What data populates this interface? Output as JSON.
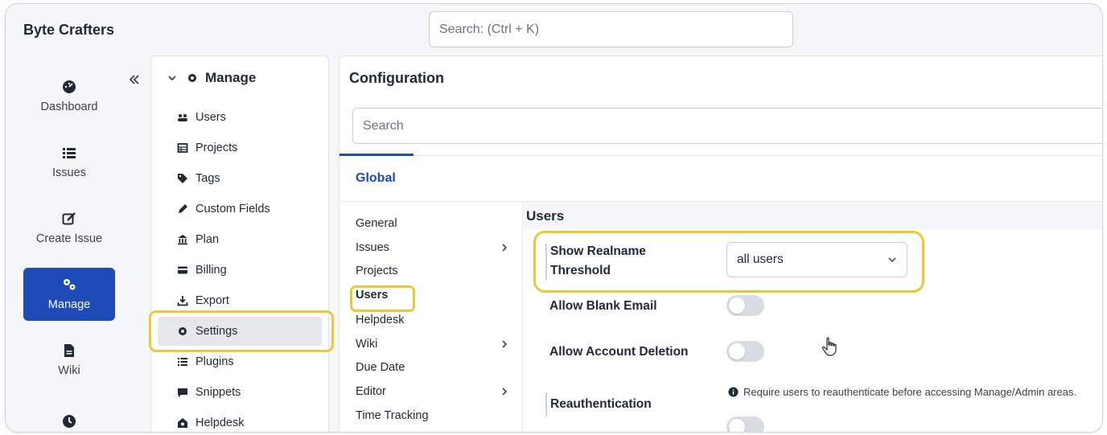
{
  "app": {
    "brand": "Byte Crafters"
  },
  "header": {
    "search_placeholder": "Search: (Ctrl + K)"
  },
  "rail": {
    "items": [
      {
        "label": "Dashboard",
        "icon": "dashboard-icon"
      },
      {
        "label": "Issues",
        "icon": "list-icon"
      },
      {
        "label": "Create Issue",
        "icon": "edit-icon"
      },
      {
        "label": "Manage",
        "icon": "gears-icon",
        "active": true
      },
      {
        "label": "Wiki",
        "icon": "document-icon"
      },
      {
        "label": "",
        "icon": "clock-icon"
      }
    ]
  },
  "manage_menu": {
    "title": "Manage",
    "items": [
      {
        "label": "Users",
        "icon": "users-icon"
      },
      {
        "label": "Projects",
        "icon": "table-icon"
      },
      {
        "label": "Tags",
        "icon": "tag-icon"
      },
      {
        "label": "Custom Fields",
        "icon": "pencil-icon"
      },
      {
        "label": "Plan",
        "icon": "bank-icon"
      },
      {
        "label": "Billing",
        "icon": "card-icon"
      },
      {
        "label": "Export",
        "icon": "download-icon"
      },
      {
        "label": "Settings",
        "icon": "gear-icon",
        "active": true
      },
      {
        "label": "Plugins",
        "icon": "list-icon"
      },
      {
        "label": "Snippets",
        "icon": "comment-icon"
      },
      {
        "label": "Helpdesk",
        "icon": "helpdesk-icon"
      }
    ]
  },
  "config": {
    "title": "Configuration",
    "search_placeholder": "Search",
    "tab": "Global",
    "sub_nav": [
      {
        "label": "General",
        "chevron": false
      },
      {
        "label": "Issues",
        "chevron": true
      },
      {
        "label": "Projects",
        "chevron": false
      },
      {
        "label": "Users",
        "chevron": false,
        "active": true
      },
      {
        "label": "Helpdesk",
        "chevron": false
      },
      {
        "label": "Wiki",
        "chevron": true
      },
      {
        "label": "Due Date",
        "chevron": false
      },
      {
        "label": "Editor",
        "chevron": true
      },
      {
        "label": "Time Tracking",
        "chevron": false
      }
    ],
    "section": {
      "title": "Users",
      "show_realname_label_1": "Show Realname",
      "show_realname_label_2": "Threshold",
      "show_realname_value": "all users",
      "allow_blank_email_label": "Allow Blank Email",
      "allow_blank_email_on": false,
      "allow_account_deletion_label": "Allow Account Deletion",
      "allow_account_deletion_on": false,
      "reauth_label": "Reauthentication",
      "reauth_info": "Require users to reauthenticate before accessing Manage/Admin areas.",
      "reauth_on": false
    }
  },
  "colors": {
    "accent": "#1e4bb8",
    "highlight": "#efc53a"
  }
}
